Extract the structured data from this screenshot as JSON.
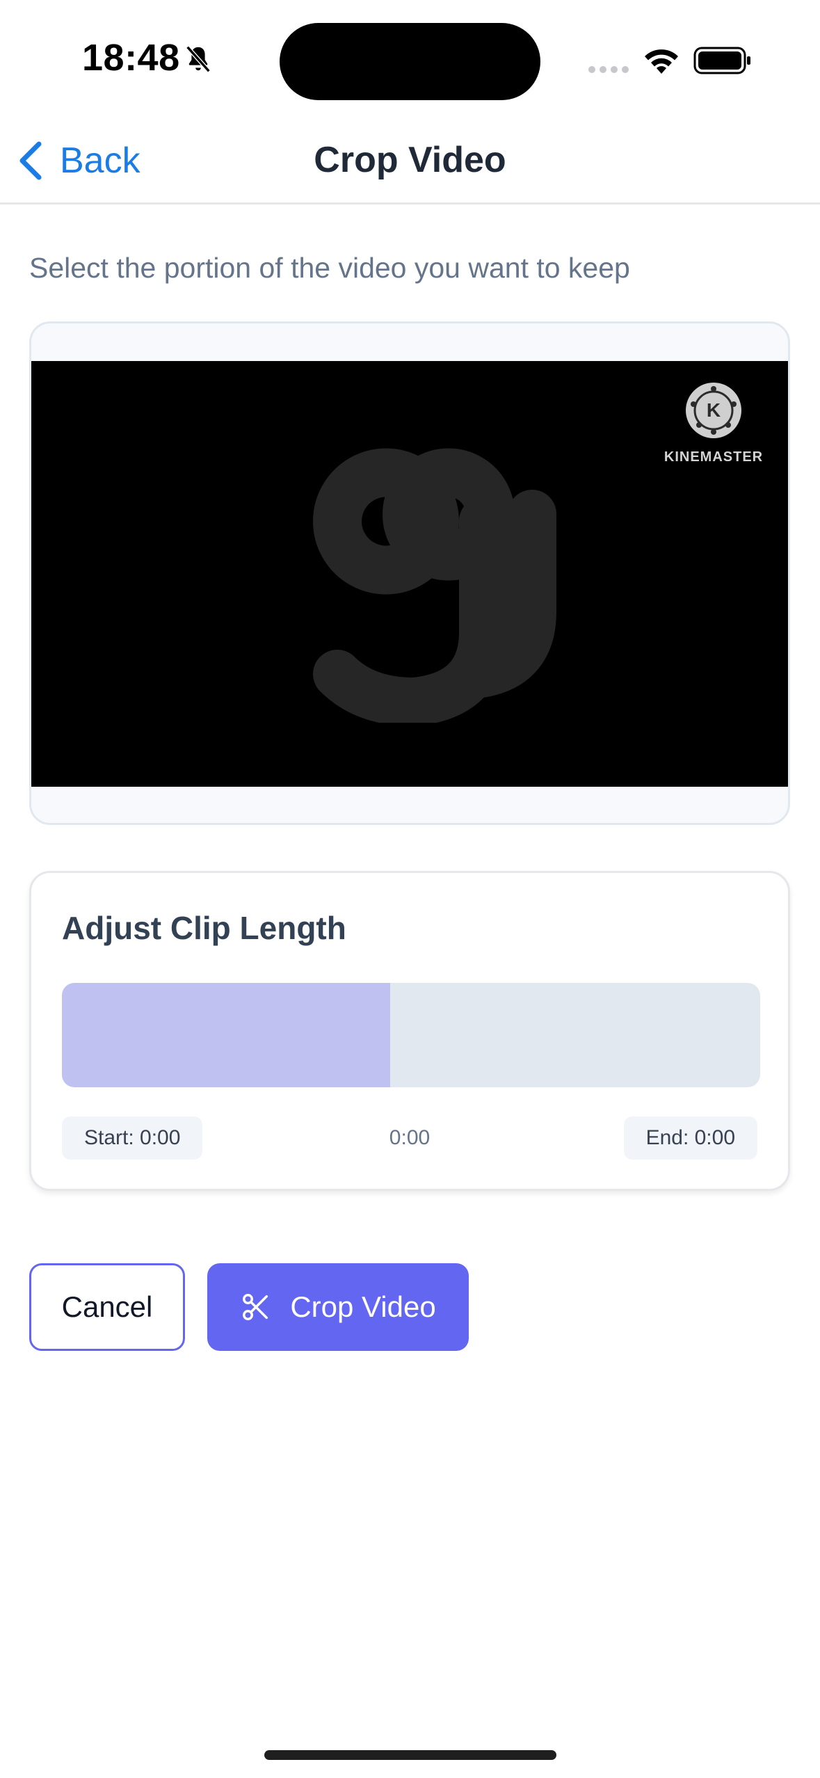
{
  "status_bar": {
    "time": "18:48",
    "bell_icon": "bell-slash-icon",
    "signal_icon": "signal-icon",
    "wifi_icon": "wifi-icon",
    "battery_icon": "battery-icon"
  },
  "nav": {
    "back_label": "Back",
    "title": "Crop Video",
    "accent_color": "#1b7ce6"
  },
  "instruction": "Select the portion of the video you want to keep",
  "video": {
    "watermark": "KINEMASTER",
    "watermark_logo_letter": "K"
  },
  "clip": {
    "title": "Adjust Clip Length",
    "start_label": "Start: 0:00",
    "current_time": "0:00",
    "end_label": "End: 0:00",
    "selected_fraction": 0.47,
    "fill_color": "#bfc2f0",
    "track_color": "#e2e8f0"
  },
  "actions": {
    "cancel_label": "Cancel",
    "crop_label": "Crop Video",
    "crop_icon": "scissors-icon",
    "primary_color": "#6366f1"
  }
}
